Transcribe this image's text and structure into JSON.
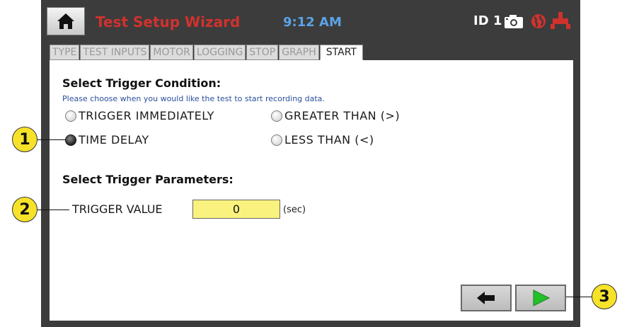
{
  "header": {
    "title": "Test Setup Wizard",
    "time": "9:12 AM",
    "id_label": "ID 1",
    "icons": [
      "home-icon",
      "camera-icon",
      "globe-icon",
      "plug-icon"
    ]
  },
  "tabs": [
    {
      "label": "TYPE",
      "active": false
    },
    {
      "label": "TEST INPUTS",
      "active": false
    },
    {
      "label": "MOTOR",
      "active": false
    },
    {
      "label": "LOGGING",
      "active": false
    },
    {
      "label": "STOP",
      "active": false
    },
    {
      "label": "GRAPH",
      "active": false
    },
    {
      "label": "START",
      "active": true
    }
  ],
  "trigger_condition": {
    "heading": "Select Trigger Condition:",
    "hint": "Please choose when you would like the test to start recording data.",
    "options": [
      {
        "label": "TRIGGER IMMEDIATELY",
        "selected": false
      },
      {
        "label": "GREATER THAN (>)",
        "selected": false
      },
      {
        "label": "TIME DELAY",
        "selected": true
      },
      {
        "label": "LESS THAN (<)",
        "selected": false
      }
    ]
  },
  "trigger_parameters": {
    "heading": "Select Trigger Parameters:",
    "label": "TRIGGER VALUE",
    "value": "0",
    "unit": "(sec)"
  },
  "navigation": {
    "back_icon": "arrow-left-icon",
    "next_icon": "play-icon"
  },
  "callouts": [
    "1",
    "2",
    "3"
  ],
  "colors": {
    "title": "#d0322e",
    "time": "#5aa3e6",
    "input_bg": "#f9f27e",
    "next_arrow": "#22c12a",
    "callout": "#f7e22a"
  }
}
